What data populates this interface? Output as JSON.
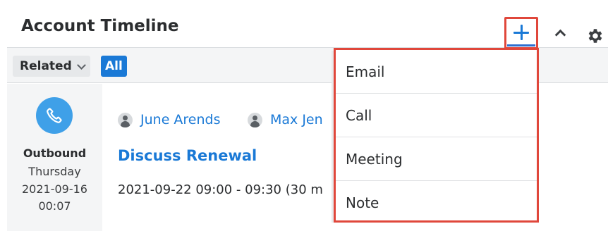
{
  "dashlet": {
    "title": "Account Timeline",
    "add_icon": "plus-icon",
    "collapse_icon": "chevron-up-icon",
    "settings_icon": "gear-icon"
  },
  "filters": {
    "related_label": "Related",
    "related_icon": "chevron-down-icon",
    "all_label": "All"
  },
  "timeline_item": {
    "type_icon": "phone-icon",
    "direction": "Outbound",
    "day": "Thursday",
    "date": "2021-09-16",
    "time": "00:07",
    "participants": [
      "June Arends",
      "Max Jen"
    ],
    "subject": "Discuss Renewal",
    "time_range": "2021-09-22 09:00 - 09:30 (30 m"
  },
  "add_menu": {
    "items": [
      "Email",
      "Call",
      "Meeting",
      "Note"
    ]
  },
  "colors": {
    "accent": "#1a79d6",
    "highlight": "#e0473b",
    "call_icon_bg": "#3fa0e8"
  }
}
